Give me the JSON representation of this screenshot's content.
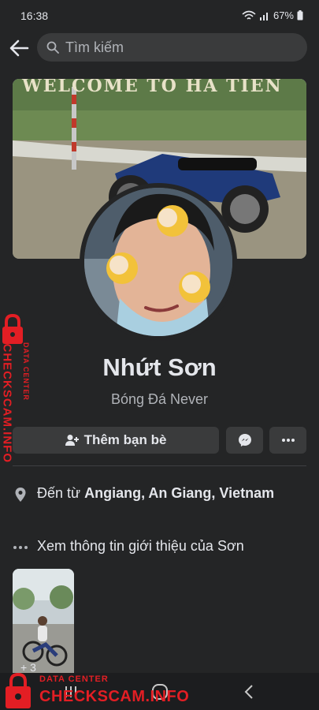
{
  "status_bar": {
    "time": "16:38",
    "battery": "67%"
  },
  "search": {
    "placeholder": "Tìm kiếm"
  },
  "cover": {
    "sign_text": "WELCOME TO HA TIEN"
  },
  "profile": {
    "name": "Nhứt Sơn",
    "bio": "Bóng Đá Never"
  },
  "actions": {
    "add_friend_label": "Thêm bạn bè"
  },
  "info": {
    "from_prefix": "Đến từ ",
    "from_place": "Angiang, An Giang, Vietnam",
    "about_label": "Xem thông tin giới thiệu của Sơn"
  },
  "photos": {
    "more_count": "+ 3"
  },
  "watermark": {
    "top_line": "DATA CENTER",
    "brand": "CHECKSCAM.INFO"
  },
  "colors": {
    "background": "#242526",
    "button": "#3a3b3c",
    "text_primary": "#e4e6eb",
    "text_secondary": "#b0b3b8",
    "watermark_red": "#e31e24"
  }
}
